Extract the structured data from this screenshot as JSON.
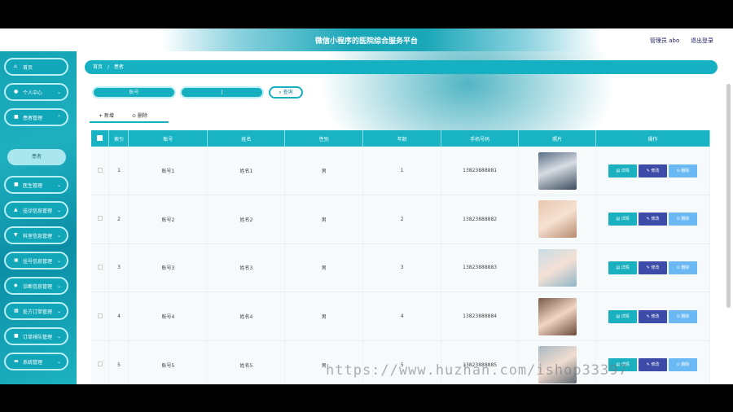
{
  "header": {
    "title": "微信小程序的医院综合服务平台",
    "admin": "管理员 abo",
    "logout": "退出登录"
  },
  "sidebar": {
    "items": [
      {
        "label": "首页",
        "icon": "home-icon",
        "chev": ""
      },
      {
        "label": "个人中心",
        "icon": "user-icon",
        "chev": "⌄"
      },
      {
        "label": "患者管理",
        "icon": "grid-icon",
        "chev": "⌃"
      },
      {
        "label": "医生管理",
        "icon": "grid-icon",
        "chev": "⌄"
      },
      {
        "label": "挂诊信息管理",
        "icon": "building-icon",
        "chev": "⌄"
      },
      {
        "label": "科室信息管理",
        "icon": "ribbon-icon",
        "chev": "⌄"
      },
      {
        "label": "挂号信息管理",
        "icon": "clipboard-icon",
        "chev": "⌄"
      },
      {
        "label": "诊断信息管理",
        "icon": "chart-icon",
        "chev": "⌄"
      },
      {
        "label": "处方订单管理",
        "icon": "table-icon",
        "chev": "⌄"
      },
      {
        "label": "订单排队管理",
        "icon": "grid-icon",
        "chev": "⌄"
      },
      {
        "label": "系统管理",
        "icon": "briefcase-icon",
        "chev": "⌄"
      }
    ],
    "sub_item": "患者"
  },
  "breadcrumb": {
    "home": "首页",
    "sep": "/",
    "current": "患者"
  },
  "search": {
    "account_placeholder": "账号",
    "name_value": "|",
    "button": "查询"
  },
  "tabs": {
    "add": "新增",
    "delete": "删除"
  },
  "table": {
    "headers": [
      "索引",
      "账号",
      "姓名",
      "性别",
      "年龄",
      "手机号码",
      "照片",
      "操作"
    ],
    "rows": [
      {
        "idx": "1",
        "account": "账号1",
        "name": "姓名1",
        "gender": "男",
        "age": "1",
        "phone": "13823888881"
      },
      {
        "idx": "2",
        "account": "账号2",
        "name": "姓名2",
        "gender": "男",
        "age": "2",
        "phone": "13823888882"
      },
      {
        "idx": "3",
        "account": "账号3",
        "name": "姓名3",
        "gender": "男",
        "age": "3",
        "phone": "13823888883"
      },
      {
        "idx": "4",
        "account": "账号4",
        "name": "姓名4",
        "gender": "男",
        "age": "4",
        "phone": "13823888884"
      },
      {
        "idx": "5",
        "account": "账号5",
        "name": "姓名5",
        "gender": "男",
        "age": "5",
        "phone": "13823888885"
      }
    ],
    "actions": {
      "detail": "详情",
      "edit": "修改",
      "delete": "删除"
    }
  },
  "watermark": "https://www.huzhan.com/ishop33397",
  "colors": {
    "accent": "#16afbf",
    "edit": "#3d4ca8",
    "delete": "#6ab9f5"
  }
}
